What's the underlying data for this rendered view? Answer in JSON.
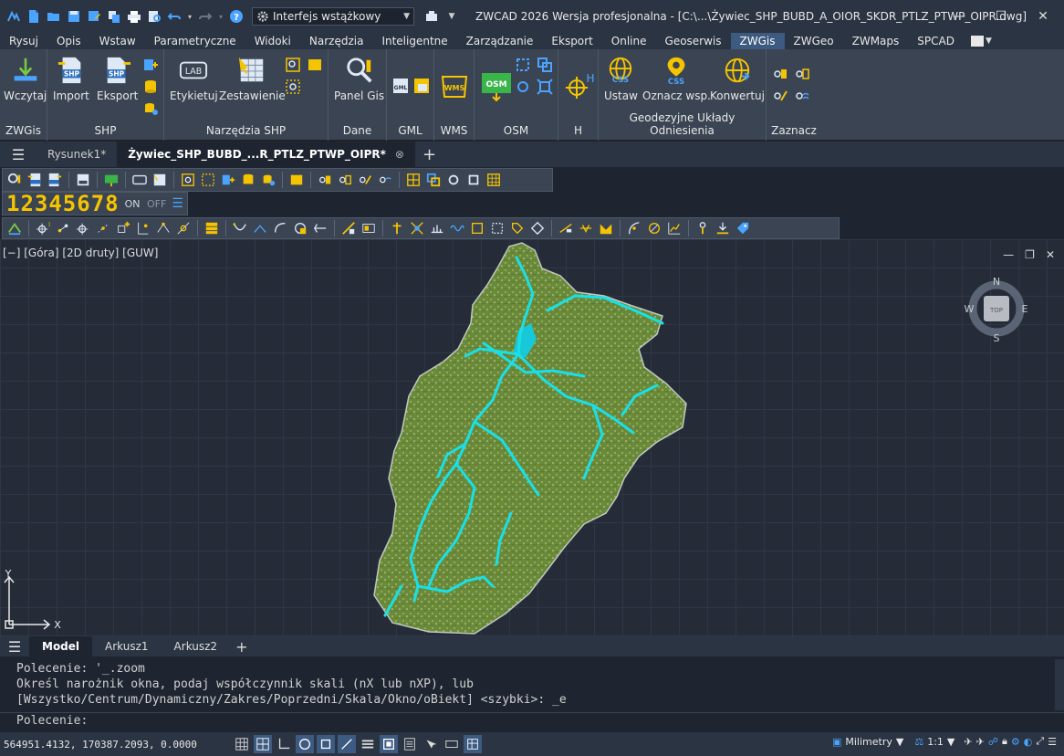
{
  "titlebar": {
    "workspace": "Interfejs wstążkowy",
    "title": "ZWCAD 2026 Wersja profesjonalna - [C:\\...\\Żywiec_SHP_BUBD_A_OIOR_SKDR_PTLZ_PTWP_OIPR.dwg]"
  },
  "menu": [
    "Rysuj",
    "Opis",
    "Wstaw",
    "Parametryczne",
    "Widoki",
    "Narzędzia",
    "Inteligentne",
    "Zarządzanie",
    "Eksport",
    "Online",
    "Geoserwis",
    "ZWGis",
    "ZWGeo",
    "ZWMaps",
    "SPCAD"
  ],
  "ribbon": {
    "panels": {
      "zwgis": "ZWGis",
      "shp": "SHP",
      "tools": "Narzędzia SHP",
      "data": "Dane",
      "gml": "GML",
      "wms": "WMS",
      "osm": "OSM",
      "h": "H",
      "geo": "Geodezyjne Układy Odniesienia",
      "mark": "Zaznacz"
    },
    "buttons": {
      "load": "Wczytaj",
      "import": "Import",
      "export": "Eksport",
      "label": "Etykietuj",
      "summary": "Zestawienie",
      "gis_panel": "Panel Gis",
      "set": "Ustaw",
      "mark_pt": "Oznacz wsp.",
      "convert": "Konwertuj"
    },
    "icon_text": {
      "shp": "SHP",
      "lab": "LAB",
      "gml": "GML",
      "wms": "WMS",
      "osm": "OSM",
      "css": "CSS",
      "h": "H"
    }
  },
  "doctabs": {
    "tab1": "Rysunek1*",
    "tab2": "Żywiec_SHP_BUBD_...R_PTLZ_PTWP_OIPR*",
    "close": "⊗",
    "add": "+"
  },
  "numstrip": {
    "digits": "12345678",
    "on": "ON",
    "off": "OFF"
  },
  "viewport": {
    "label": "[−] [Góra] [2D druty] [GUW]",
    "viewcube": {
      "n": "N",
      "s": "S",
      "e": "E",
      "w": "W",
      "top": "TOP"
    },
    "axis": {
      "x": "X",
      "y": "Y"
    }
  },
  "layouttabs": [
    "Model",
    "Arkusz1",
    "Arkusz2"
  ],
  "command": {
    "history": [
      "Polecenie: '_.zoom",
      "Określ narożnik okna, podaj współczynnik skali (nX lub nXP), lub",
      "[Wszystko/Centrum/Dynamiczny/Zakres/Poprzedni/Skala/Okno/oBiekt] <szybki>: _e"
    ],
    "prompt": "Polecenie:"
  },
  "status": {
    "coords": "564951.4132, 170387.2093, 0.0000",
    "units": "Milimetry",
    "scale": "1:1"
  },
  "colors": {
    "accent": "#3d5a80",
    "river": "#19e0e8",
    "terrain": "#6a8a3a",
    "yellow": "#f5c400"
  }
}
